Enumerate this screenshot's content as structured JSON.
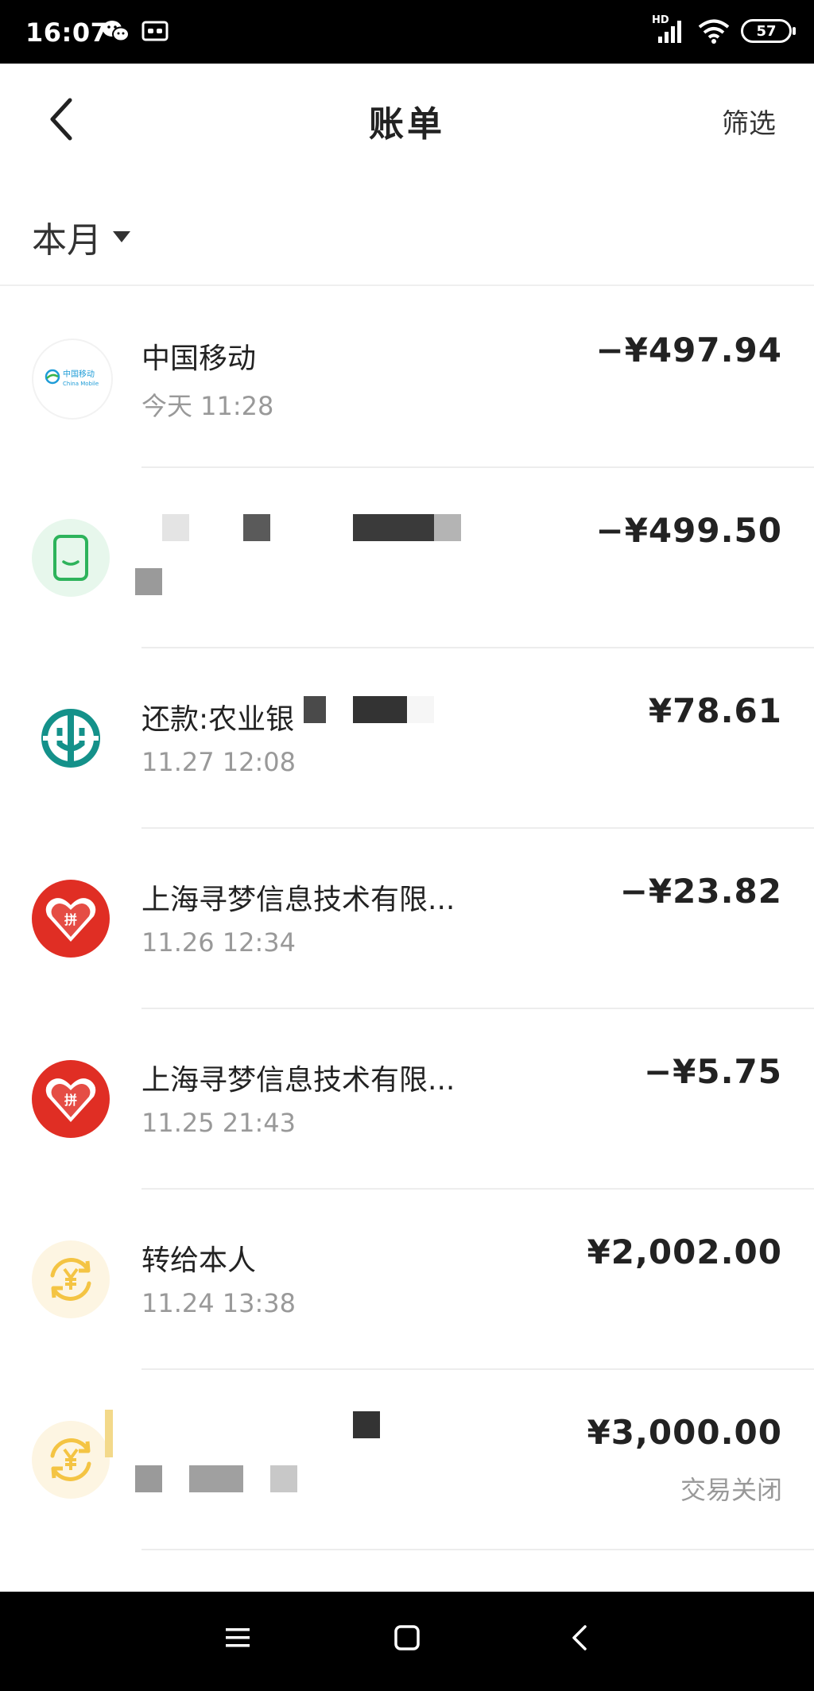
{
  "status_bar": {
    "time": "16:07",
    "network": "HD",
    "battery": "57"
  },
  "header": {
    "title": "账单",
    "filter_label": "筛选"
  },
  "month_selector": {
    "label": "本月"
  },
  "transactions": [
    {
      "title": "中国移动",
      "subtitle": "今天 11:28",
      "amount": "−¥497.94",
      "status": "",
      "icon": "china-mobile-logo",
      "logo_text": "中国移动",
      "logo_subtext": "China Mobile"
    },
    {
      "title": "",
      "subtitle": "",
      "amount": "−¥499.50",
      "status": "",
      "icon": "phone-icon"
    },
    {
      "title": "还款:农业银",
      "subtitle": "11.27 12:08",
      "amount": "¥78.61",
      "status": "",
      "icon": "agricultural-bank-logo"
    },
    {
      "title": "上海寻梦信息技术有限...",
      "subtitle": "11.26 12:34",
      "amount": "−¥23.82",
      "status": "",
      "icon": "pinduoduo-logo",
      "logo_text": "拼"
    },
    {
      "title": "上海寻梦信息技术有限...",
      "subtitle": "11.25 21:43",
      "amount": "−¥5.75",
      "status": "",
      "icon": "pinduoduo-logo",
      "logo_text": "拼"
    },
    {
      "title": "转给本人",
      "subtitle": "11.24 13:38",
      "amount": "¥2,002.00",
      "status": "",
      "icon": "transfer-yuan-icon"
    },
    {
      "title": "",
      "subtitle": "",
      "amount": "¥3,000.00",
      "status": "交易关闭",
      "icon": "transfer-yuan-icon"
    }
  ],
  "colors": {
    "accent_green": "#2db35b",
    "bank_teal": "#14918a",
    "pdd_red": "#e02e24",
    "transfer_yellow": "#f4c443"
  }
}
